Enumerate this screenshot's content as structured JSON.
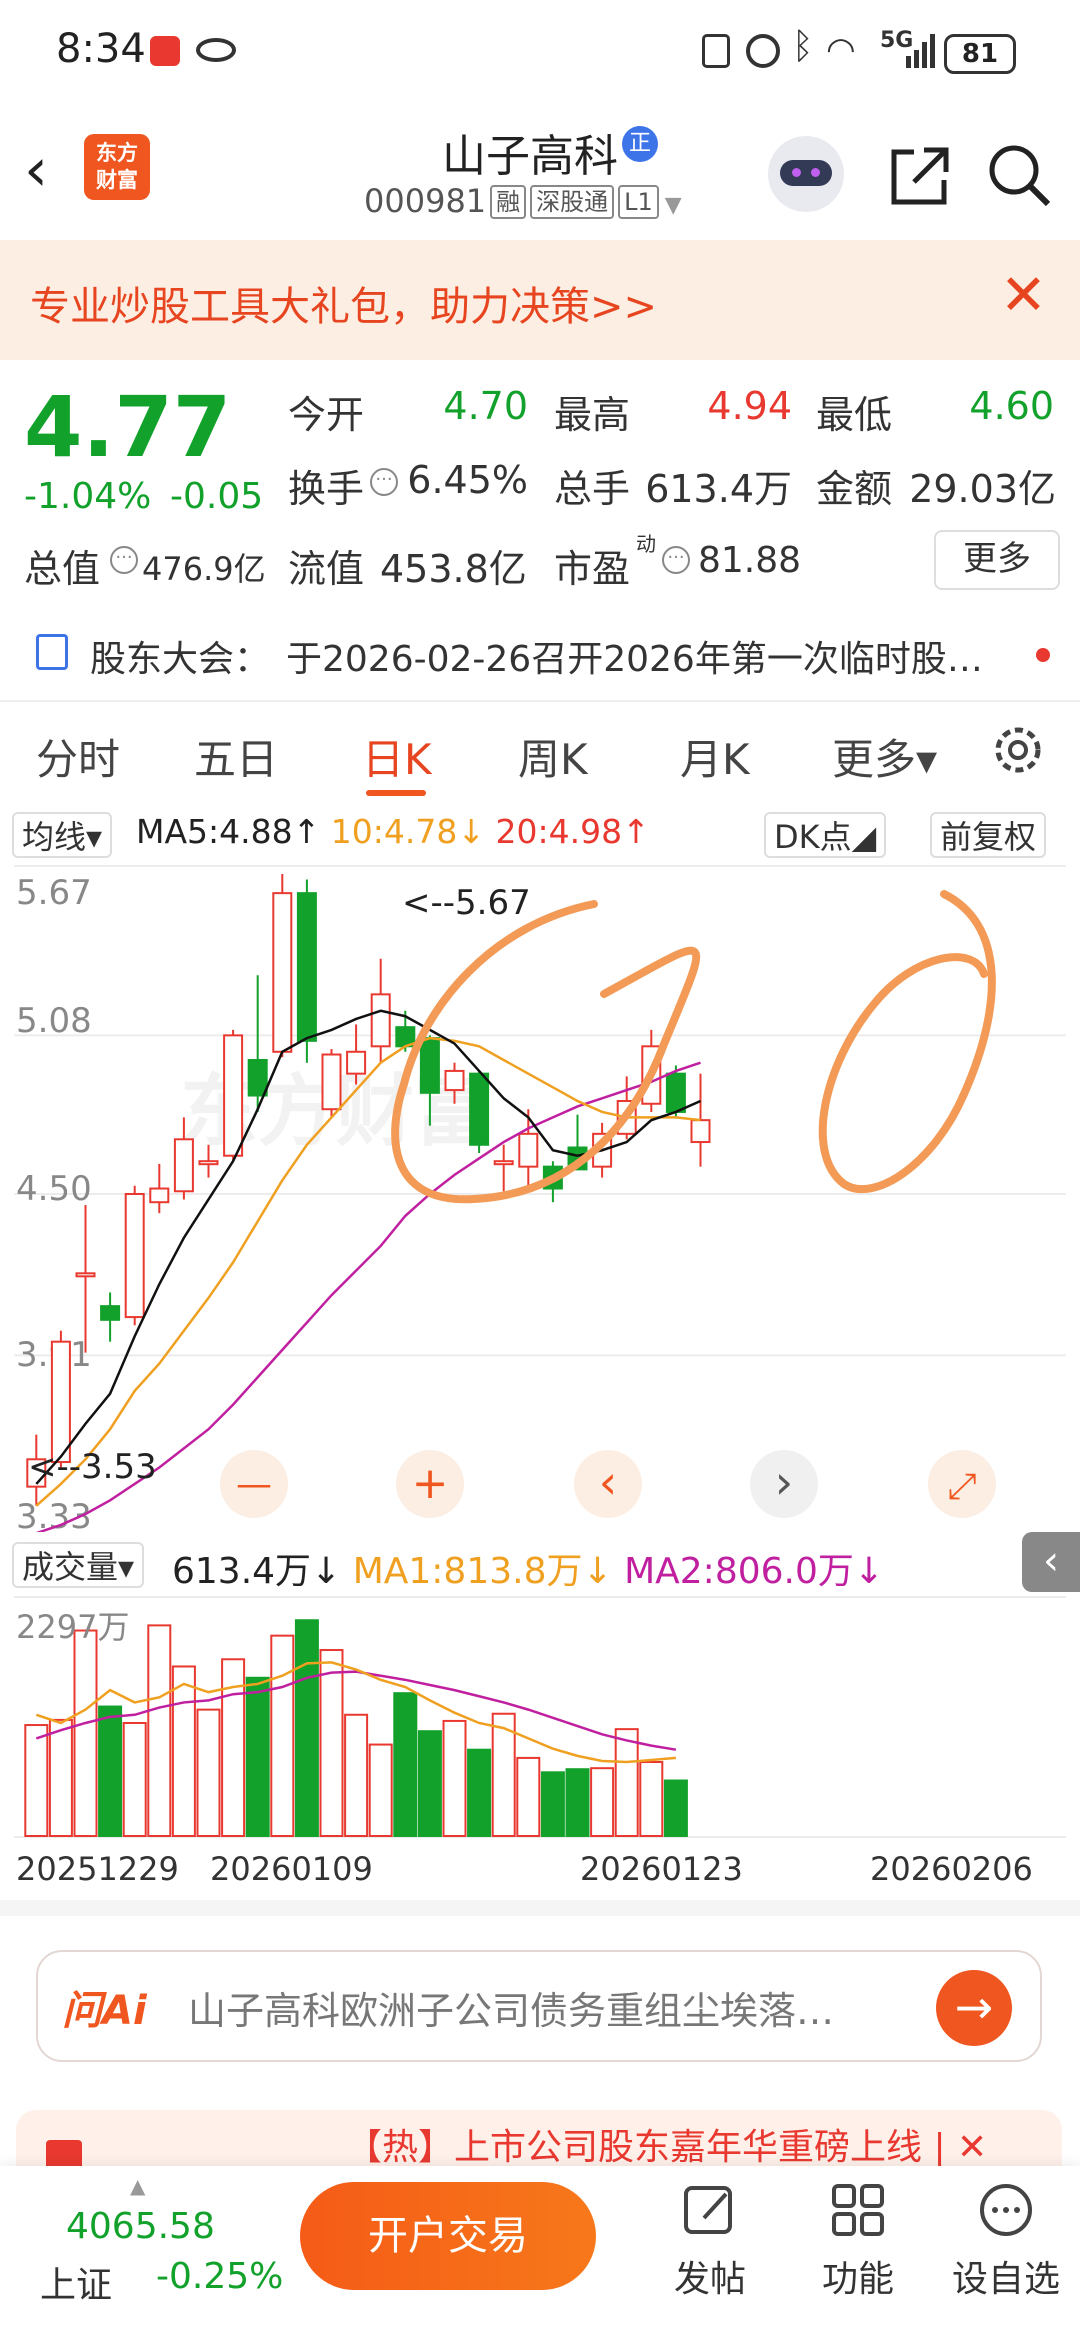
{
  "status": {
    "time": "8:34",
    "network": "5G",
    "battery": "81"
  },
  "header": {
    "back": "‹",
    "logo_text": "东方\n财富",
    "stock_name": "山子高科",
    "badge": "正",
    "code": "000981",
    "tags": [
      "融",
      "深股通",
      "L1"
    ]
  },
  "promo": {
    "text": "专业炒股工具大礼包，助力决策>>",
    "close": "✕"
  },
  "quote": {
    "price": "4.77",
    "change_pct": "-1.04%",
    "change_amt": "-0.05",
    "open_label": "今开",
    "open": "4.70",
    "high_label": "最高",
    "high": "4.94",
    "low_label": "最低",
    "low": "4.60",
    "turnover_label": "换手",
    "turnover": "6.45%",
    "volume_label": "总手",
    "volume": "613.4万",
    "amount_label": "金额",
    "amount": "29.03亿",
    "mktcap_label": "总值",
    "mktcap": "476.9亿",
    "float_label": "流值",
    "float": "453.8亿",
    "pe_label": "市盈",
    "pe_sup": "动",
    "pe": "81.88",
    "more": "更多"
  },
  "meeting": {
    "label": "股东大会：",
    "text": "于2026-02-26召开2026年第一次临时股…"
  },
  "tabs": [
    "分时",
    "五日",
    "日K",
    "周K",
    "月K",
    "更多▾"
  ],
  "chart_header": {
    "ma_select": "均线▾",
    "ma5": "MA5:4.88↑",
    "ma10": "10:4.78↓",
    "ma20": "20:4.98↑",
    "dk": "DK点◢",
    "adjust": "前复权"
  },
  "volume_header": {
    "select": "成交量▾",
    "vol": "613.4万↓",
    "ma1": "MA1:813.8万↓",
    "ma2": "MA2:806.0万↓",
    "max_label": "2297万",
    "collapse": "‹"
  },
  "chart_controls": {
    "minus": "—",
    "plus": "+",
    "left": "‹",
    "right": "›",
    "expand": "⤢"
  },
  "dates": [
    "20251229",
    "20260109",
    "20260123",
    "20260206"
  ],
  "ai": {
    "logo": "问Ai",
    "text": "山子高科欧洲子公司债务重组尘埃落…",
    "arrow": "→"
  },
  "news": {
    "text": "【热】上市公司股东嘉年华重磅上线 | ✕"
  },
  "bottom": {
    "index_value": "4065.58",
    "index_name": "上证",
    "index_change": "-0.25%",
    "trade": "开户交易",
    "nav": [
      "发帖",
      "功能",
      "设自选"
    ]
  },
  "colors": {
    "up": "#e8382f",
    "down": "#12a12b",
    "ma5": "#111111",
    "ma10": "#f0a020",
    "ma20": "#c020a0",
    "accent": "#f0561f"
  },
  "chart_data": {
    "type": "candlestick",
    "y_ticks": [
      "5.67",
      "5.08",
      "4.50",
      "3.91",
      "3.33"
    ],
    "ylim": [
      3.33,
      5.67
    ],
    "annotations": {
      "high": "<--5.67",
      "low": "<--3.53"
    },
    "candles": [
      {
        "o": 3.43,
        "h": 3.62,
        "l": 3.36,
        "c": 3.53
      },
      {
        "o": 3.52,
        "h": 4.0,
        "l": 3.5,
        "c": 3.96
      },
      {
        "o": 4.21,
        "h": 4.46,
        "l": 3.92,
        "c": 4.21
      },
      {
        "o": 4.09,
        "h": 4.14,
        "l": 3.96,
        "c": 4.04
      },
      {
        "o": 4.05,
        "h": 4.53,
        "l": 4.02,
        "c": 4.5
      },
      {
        "o": 4.47,
        "h": 4.61,
        "l": 4.43,
        "c": 4.52
      },
      {
        "o": 4.51,
        "h": 4.78,
        "l": 4.48,
        "c": 4.7
      },
      {
        "o": 4.62,
        "h": 4.68,
        "l": 4.56,
        "c": 4.62
      },
      {
        "o": 4.64,
        "h": 5.1,
        "l": 4.62,
        "c": 5.08
      },
      {
        "o": 4.99,
        "h": 5.3,
        "l": 4.8,
        "c": 4.86
      },
      {
        "o": 5.02,
        "h": 5.67,
        "l": 5.0,
        "c": 5.6
      },
      {
        "o": 5.6,
        "h": 5.65,
        "l": 4.98,
        "c": 5.06
      },
      {
        "o": 4.81,
        "h": 5.03,
        "l": 4.78,
        "c": 5.01
      },
      {
        "o": 4.94,
        "h": 5.12,
        "l": 4.9,
        "c": 5.02
      },
      {
        "o": 5.04,
        "h": 5.36,
        "l": 4.98,
        "c": 5.23
      },
      {
        "o": 5.11,
        "h": 5.17,
        "l": 5.02,
        "c": 5.04
      },
      {
        "o": 5.07,
        "h": 5.08,
        "l": 4.75,
        "c": 4.87
      },
      {
        "o": 4.88,
        "h": 4.98,
        "l": 4.83,
        "c": 4.95
      },
      {
        "o": 4.94,
        "h": 4.95,
        "l": 4.65,
        "c": 4.68
      },
      {
        "o": 4.62,
        "h": 4.68,
        "l": 4.51,
        "c": 4.62
      },
      {
        "o": 4.6,
        "h": 4.81,
        "l": 4.52,
        "c": 4.72
      },
      {
        "o": 4.6,
        "h": 4.62,
        "l": 4.47,
        "c": 4.52
      },
      {
        "o": 4.67,
        "h": 4.79,
        "l": 4.59,
        "c": 4.59
      },
      {
        "o": 4.6,
        "h": 4.76,
        "l": 4.56,
        "c": 4.72
      },
      {
        "o": 4.72,
        "h": 4.93,
        "l": 4.7,
        "c": 4.84
      },
      {
        "o": 4.83,
        "h": 5.1,
        "l": 4.8,
        "c": 5.04
      },
      {
        "o": 4.94,
        "h": 4.97,
        "l": 4.78,
        "c": 4.8
      },
      {
        "o": 4.69,
        "h": 4.94,
        "l": 4.6,
        "c": 4.77
      }
    ],
    "ma5": [
      3.44,
      3.54,
      3.66,
      3.77,
      3.98,
      4.17,
      4.34,
      4.48,
      4.62,
      4.81,
      5.02,
      5.07,
      5.1,
      5.14,
      5.17,
      5.15,
      5.1,
      5.05,
      4.95,
      4.85,
      4.78,
      4.66,
      4.64,
      4.66,
      4.69,
      4.77,
      4.8,
      4.84
    ],
    "ma10": [
      3.36,
      3.44,
      3.53,
      3.64,
      3.78,
      3.88,
      4.0,
      4.12,
      4.25,
      4.4,
      4.55,
      4.68,
      4.78,
      4.88,
      4.98,
      5.04,
      5.07,
      5.06,
      5.04,
      4.99,
      4.94,
      4.89,
      4.84,
      4.8,
      4.78,
      4.78,
      4.78,
      4.77
    ],
    "ma20": [
      3.26,
      3.29,
      3.33,
      3.38,
      3.44,
      3.5,
      3.57,
      3.64,
      3.73,
      3.83,
      3.93,
      4.03,
      4.13,
      4.22,
      4.31,
      4.42,
      4.5,
      4.57,
      4.63,
      4.69,
      4.74,
      4.78,
      4.82,
      4.85,
      4.88,
      4.91,
      4.95,
      4.98
    ],
    "volume_wan": [
      1080,
      1130,
      2000,
      1260,
      1100,
      2050,
      1650,
      1230,
      1720,
      1540,
      1950,
      2100,
      1810,
      1180,
      890,
      1390,
      1020,
      1120,
      840,
      1190,
      760,
      620,
      650,
      660,
      1040,
      720,
      540
    ],
    "vol_ma1": [
      1180,
      1100,
      1230,
      1420,
      1300,
      1350,
      1480,
      1400,
      1450,
      1480,
      1560,
      1680,
      1690,
      1620,
      1520,
      1450,
      1320,
      1200,
      1100,
      1050,
      950,
      850,
      780,
      730,
      720,
      740,
      760
    ],
    "vol_ma2": [
      950,
      1030,
      1100,
      1160,
      1180,
      1250,
      1300,
      1320,
      1380,
      1400,
      1450,
      1540,
      1590,
      1600,
      1560,
      1520,
      1470,
      1420,
      1360,
      1300,
      1230,
      1150,
      1070,
      990,
      930,
      880,
      840
    ],
    "vol_ylim": [
      0,
      2297
    ]
  }
}
